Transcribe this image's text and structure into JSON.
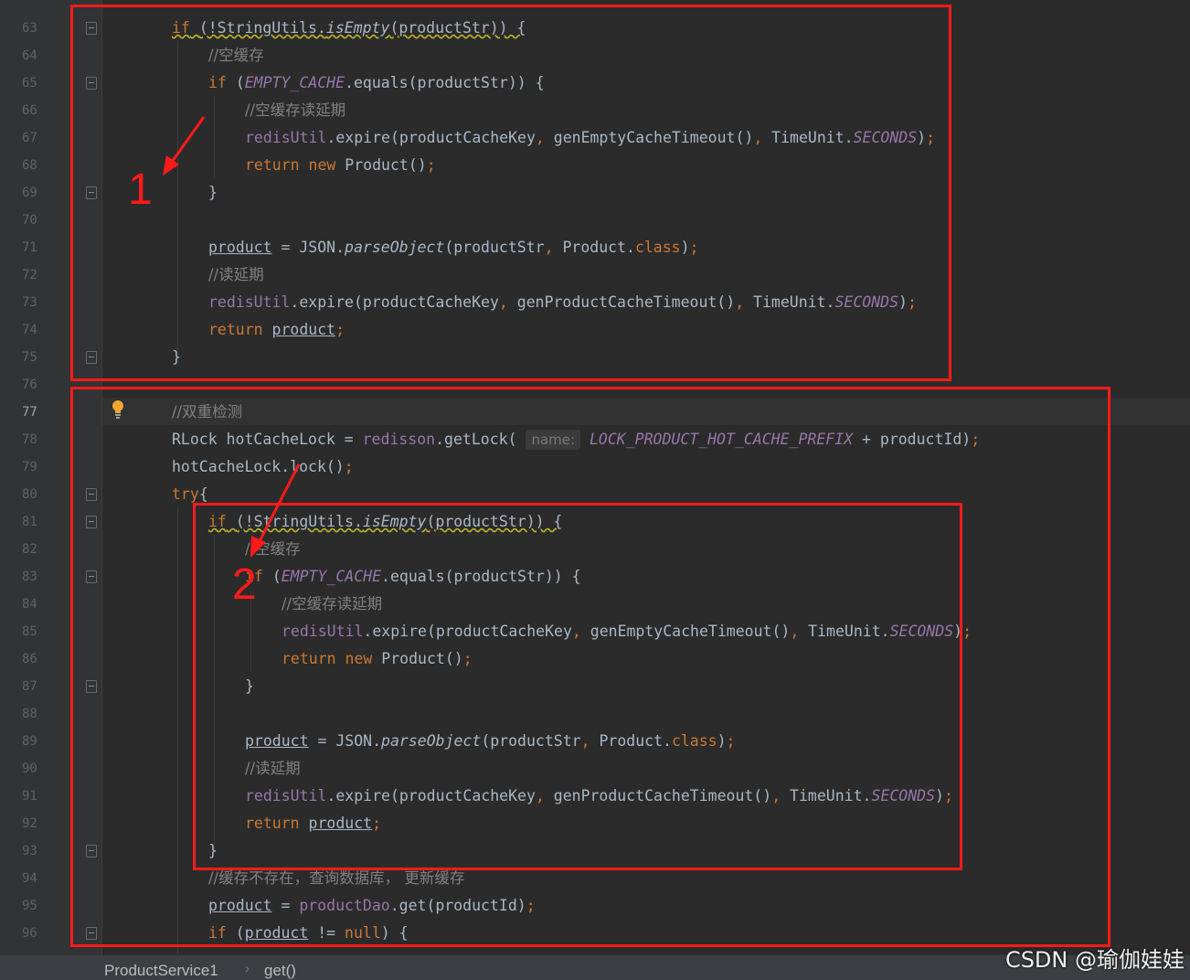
{
  "editor": {
    "current_line": 77,
    "colors": {
      "background": "#2b2b2b",
      "keyword": "#cc7832",
      "comment": "#808080",
      "field": "#9876aa",
      "text": "#a9b7c6",
      "annotation_red": "#ff1a1a"
    },
    "lines": [
      {
        "num": "63"
      },
      {
        "num": "64"
      },
      {
        "num": "65"
      },
      {
        "num": "66"
      },
      {
        "num": "67"
      },
      {
        "num": "68"
      },
      {
        "num": "69"
      },
      {
        "num": "70"
      },
      {
        "num": "71"
      },
      {
        "num": "72"
      },
      {
        "num": "73"
      },
      {
        "num": "74"
      },
      {
        "num": "75"
      },
      {
        "num": "76"
      },
      {
        "num": "77"
      },
      {
        "num": "78"
      },
      {
        "num": "79"
      },
      {
        "num": "80"
      },
      {
        "num": "81"
      },
      {
        "num": "82"
      },
      {
        "num": "83"
      },
      {
        "num": "84"
      },
      {
        "num": "85"
      },
      {
        "num": "86"
      },
      {
        "num": "87"
      },
      {
        "num": "88"
      },
      {
        "num": "89"
      },
      {
        "num": "90"
      },
      {
        "num": "91"
      },
      {
        "num": "92"
      },
      {
        "num": "93"
      },
      {
        "num": "94"
      },
      {
        "num": "95"
      },
      {
        "num": "96"
      }
    ],
    "code": {
      "kw_if": "if",
      "kw_return": "return",
      "kw_new": "new",
      "kw_try": "try",
      "kw_class": "class",
      "kw_null": "null",
      "not_string_utils": "(!StringUtils.",
      "is_empty": "isEmpty",
      "product_str_close_brace": "(productStr)) {",
      "comment_empty_cache": "//空缓存",
      "paren_open": "(",
      "empty_cache": "EMPTY_CACHE",
      "equals_product_str": ".equals(productStr)) {",
      "comment_empty_cache_extend": "//空缓存读延期",
      "redis_util": "redisUtil",
      "expire_empty": ".expire(productCacheKey",
      "comma": ",",
      "gen_empty_timeout": " genEmptyCacheTimeout()",
      "gen_product_timeout": " genProductCacheTimeout()",
      "time_unit": " TimeUnit.",
      "seconds": "SECONDS",
      "close_paren": ")",
      "semicolon": ";",
      "product_ctor": " Product()",
      "close_brace": "}",
      "product_var": "product",
      "json_parse_prefix": " = JSON.",
      "parse_object": "parseObject",
      "parse_args": "(productStr",
      "product_class_prefix": " Product.",
      "comment_read_extend": "//读延期",
      "comment_double_check": "//双重检测",
      "rlock_decl": "RLock hotCacheLock = ",
      "redisson": "redisson",
      "get_lock": ".getLock( ",
      "hint_name": "name:",
      "lock_prefix": "LOCK_PRODUCT_HOT_CACHE_PREFIX",
      "plus_product_id": " + productId)",
      "hot_lock_call": "hotCacheLock.lock()",
      "open_brace": "{",
      "comment_cache_missing": "//缓存不存在，查询数据库， 更新缓存",
      "assign": " = ",
      "product_dao": "productDao",
      "dao_get": ".get(productId)",
      "if_paren": " (",
      "not_equals": " != ",
      "close_brace_open": ") {",
      "space": " "
    }
  },
  "annotations": {
    "label_1": "1",
    "label_2": "2"
  },
  "statusbar": {
    "crumb_class": "ProductService1",
    "crumb_method": "get()",
    "separator": "›"
  },
  "watermark": "CSDN @瑜伽娃娃",
  "icons": {
    "bulb": "lightbulb-icon",
    "fold": "fold-marker-icon"
  }
}
